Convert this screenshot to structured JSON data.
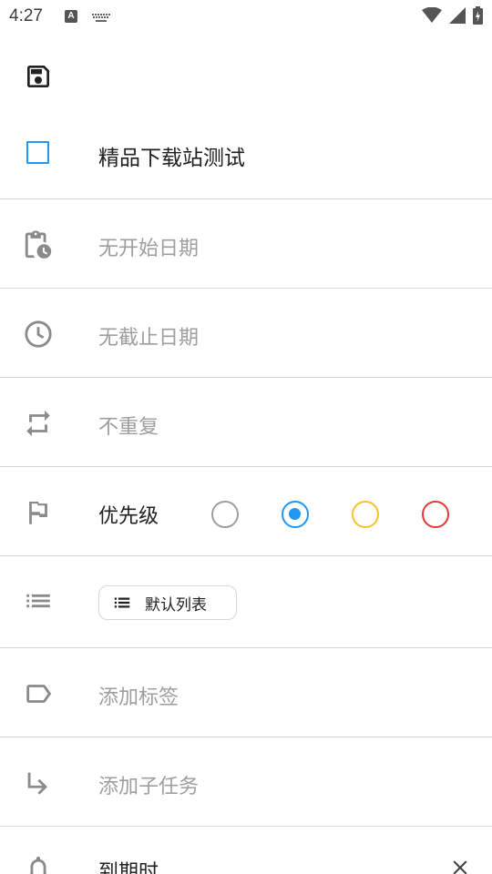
{
  "status_bar": {
    "time": "4:27",
    "notification_letter": "A"
  },
  "task": {
    "title": "精品下载站测试"
  },
  "fields": {
    "start_date": "无开始日期",
    "due_date": "无截止日期",
    "repeat": "不重复",
    "priority_label": "优先级",
    "list_name": "默认列表",
    "tags": "添加标签",
    "subtask": "添加子任务",
    "reminder": "到期时"
  },
  "priority": {
    "options": [
      "none",
      "low",
      "medium",
      "high"
    ],
    "selected": "low",
    "colors": {
      "none": "#9e9e9e",
      "low": "#2196F3",
      "medium": "#FBC02D",
      "high": "#E53935"
    }
  },
  "colors": {
    "accent": "#2196F3",
    "icon": "#8a8a8a",
    "divider": "#d6d6d6"
  },
  "icons": {
    "save": "save-icon",
    "start_date": "clipboard-clock-icon",
    "due_date": "clock-icon",
    "repeat": "repeat-icon",
    "priority": "flag-icon",
    "list": "list-icon",
    "tags": "label-icon",
    "subtask": "subdirectory-arrow-icon",
    "reminder": "bell-icon",
    "remove": "close-icon"
  }
}
